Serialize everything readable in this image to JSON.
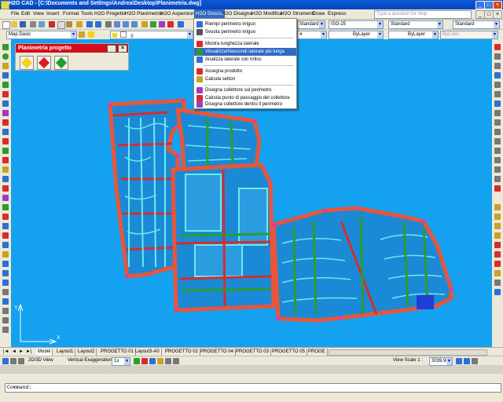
{
  "window": {
    "title": "H2O CAD - [C:\\Documents and Settings\\Andrea\\Desktop\\Planimetria.dwg]"
  },
  "menubar": {
    "items": [
      "File",
      "Edit",
      "View",
      "Insert",
      "Format",
      "Tools",
      "H2O Progetto",
      "H2O Planimetria",
      "H2O Aspersione",
      "H2O Goccia",
      "H2O Disegna",
      "H2O Modifica",
      "H2O Strumenti",
      "Draw",
      "Express"
    ],
    "active": "H2O Goccia",
    "help_placeholder": "Type a question for help"
  },
  "toolbar": {
    "layer_combo": "Map Dasic",
    "layer_number": "0",
    "dimstyle": "ISO-25",
    "text_style": "Standard",
    "table_style": "Standard",
    "bylayer1": "ByLayer",
    "bylayer2": "ByLayer",
    "bycolor": "ByColor"
  },
  "dropdown": {
    "items": [
      {
        "label": "Riempi perimetro irriguo",
        "icon": "fill-perimeter-icon",
        "color": "#2c6fd6"
      },
      {
        "label": "Svuota perimetro irriguo",
        "icon": "empty-perimeter-icon",
        "color": "#555555"
      },
      {
        "label": "Mostra lunghezza laterale",
        "icon": "show-length-icon",
        "color": "#d62c2c"
      },
      {
        "label": "Visualizza/Nascondi laterale più lunga",
        "icon": "toggle-longest-icon",
        "color": "#2c9c2c"
      },
      {
        "label": "Analizza laterale con Irriloc",
        "icon": "analyze-irriloc-icon",
        "color": "#2c6fd6"
      },
      {
        "label": "Assegna prodotto",
        "icon": "assign-product-icon",
        "color": "#d62c2c"
      },
      {
        "label": "Calcola settori",
        "icon": "calc-sectors-icon",
        "color": "#c9a227"
      },
      {
        "label": "Disegna collettore sul perimetro",
        "icon": "draw-collector-icon",
        "color": "#a03ac9"
      },
      {
        "label": "Calcola punto di passaggio del collettore",
        "icon": "calc-passage-icon",
        "color": "#d62c2c"
      },
      {
        "label": "Disegna collettore dentro il perimetro",
        "icon": "draw-collector-inside-icon",
        "color": "#a03ac9"
      }
    ],
    "highlighted_index": 3
  },
  "palette": {
    "title": "Planimetria progetto",
    "buttons": [
      {
        "name": "yellow-diamond-button",
        "color": "#f2d21c"
      },
      {
        "name": "red-diamond-button",
        "color": "#d81e1e"
      },
      {
        "name": "green-diamond-button",
        "color": "#1e9c2e"
      }
    ]
  },
  "tabs": {
    "items": [
      "Model",
      "Layout1",
      "Layout2",
      "PROGETTO 01",
      "Layout3-A0",
      "PROGETTO 02",
      "PROGETTO 04",
      "PROGETTO 03",
      "PROGETTO 05",
      "PROGE"
    ],
    "selected": "Model"
  },
  "statusbar": {
    "view_2d3d": "2D/3D View",
    "vertical_exaggeration_label": "Vertical Exaggeration:",
    "vertical_exaggeration": "1x",
    "view_scale_label": "View Scale 1 :",
    "view_scale": "3039.96"
  },
  "command": {
    "prompt": "Command:"
  },
  "colors": {
    "canvas": "#14a2f0",
    "accent": "#316ac5",
    "palette_title": "#d30d1a"
  }
}
